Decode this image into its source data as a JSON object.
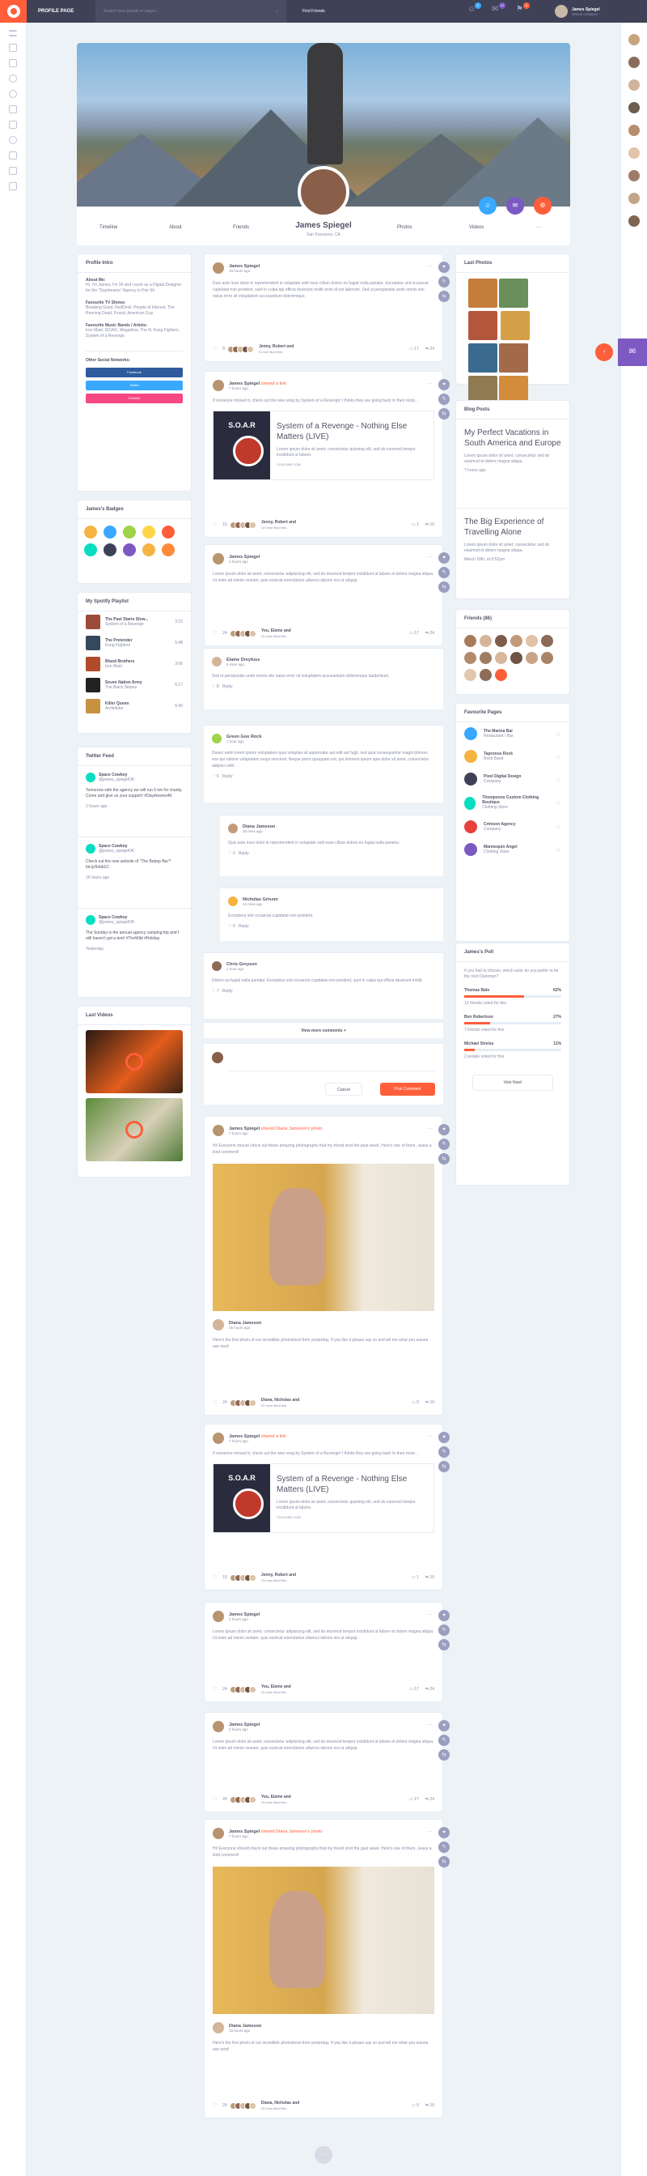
{
  "topbar": {
    "page_title": "PROFILE PAGE",
    "search_placeholder": "Search here people or pages...",
    "find_friends": "Find Friends",
    "notif_counts": [
      "6",
      "12",
      "8"
    ],
    "user_name": "James Spiegel",
    "user_status": "SPACE COWBOY"
  },
  "profile": {
    "name": "James Spiegel",
    "location": "San Francisco, CA",
    "tabs_left": [
      "Timeline",
      "About",
      "Friends"
    ],
    "tabs_right": [
      "Photos",
      "Videos",
      "···"
    ]
  },
  "intro": {
    "title": "Profile Intro",
    "about_label": "About Me:",
    "about_text": "Hi, I'm James, I'm 36 and I work as a Digital Designer for the \"Daydreams\" Agency in Pier 56.",
    "tv_label": "Favourite TV Shows:",
    "tv_text": "Breaking Good, RedDevil, People of Interest, The Running Dead, Found, American Guy.",
    "music_label": "Favourite Music Bands / Artists:",
    "music_text": "Iron Maid, DC/AC, Megablow, The Ill, Kung Fighters, System of a Revenge.",
    "social_label": "Other Social Networks:",
    "social": [
      "Facebook",
      "Twitter",
      "Dribbble"
    ]
  },
  "badges": {
    "title": "James's Badges"
  },
  "playlist": {
    "title": "My Spotify Playlist",
    "items": [
      {
        "song": "The Past Starts Slow...",
        "artist": "System of a Revenge",
        "time": "3:22"
      },
      {
        "song": "The Pretender",
        "artist": "Kung Fighters",
        "time": "5:48"
      },
      {
        "song": "Blood Brothers",
        "artist": "Iron Maid",
        "time": "3:06"
      },
      {
        "song": "Seven Nation Army",
        "artist": "The Black Stripes",
        "time": "6:17"
      },
      {
        "song": "Killer Queen",
        "artist": "Archiduke",
        "time": "5:40"
      }
    ]
  },
  "twitter": {
    "title": "Twitter Feed",
    "tweets": [
      {
        "name": "Space Cowboy",
        "handle": "@james_spiegelOK",
        "text": "Tomorrow with the agency we will run 5 km for charity. Come and give us your support! #Daydreams4K",
        "time": "2 hours ago"
      },
      {
        "name": "Space Cowboy",
        "handle": "@james_spiegelOK",
        "text": "Check out the new website of \"The Bebop Bar\"! bit.ly/9xbb1C",
        "time": "16 hours ago"
      },
      {
        "name": "Space Cowboy",
        "handle": "@james_spiegelOK",
        "text": "The Sunday is the annual agency camping trip and I still haven't got a tent! #TheWild #Holiday",
        "time": "Yesterday"
      }
    ]
  },
  "videos": {
    "title": "Last Videos"
  },
  "photos": {
    "title": "Last Photos"
  },
  "blog": {
    "title": "Blog Posts",
    "items": [
      {
        "title": "My Perfect Vacations in South America and Europe",
        "text": "Lorem ipsum dolor sit amet, consectetur sed do eiusmod et dolore magna aliqua.",
        "time": "7 hours ago"
      },
      {
        "title": "The Big Experience of Travelling Alone",
        "text": "Lorem ipsum dolor sit amet, consectetur sed do eiusmod et dolore magna aliqua.",
        "time": "March 18th, at 6:52pm"
      }
    ]
  },
  "friends": {
    "title": "Friends (86)"
  },
  "pages": {
    "title": "Favourite Pages",
    "items": [
      {
        "name": "The Marina Bar",
        "type": "Restaurant / Bar"
      },
      {
        "name": "Tapronus Rock",
        "type": "Rock Band"
      },
      {
        "name": "Pixel Digital Design",
        "type": "Company"
      },
      {
        "name": "Thompsons Custom Clothing Boutique",
        "type": "Clothing Store"
      },
      {
        "name": "Crimson Agency",
        "type": "Company"
      },
      {
        "name": "Mannequin Angel",
        "type": "Clothing Store"
      }
    ]
  },
  "poll": {
    "title": "James's Poll",
    "question": "If you had to choose, which actor do you prefer to be the next Darkman?",
    "options": [
      {
        "name": "Thomas Bale",
        "pct": "62%",
        "voted": "12 friends voted for this"
      },
      {
        "name": "Ben Robertson",
        "pct": "27%",
        "voted": "7 friends voted for this"
      },
      {
        "name": "Michael Streiss",
        "pct": "11%",
        "voted": "2 people voted for this"
      }
    ],
    "pcts": [
      0.62,
      0.27,
      0.11
    ],
    "button": "Vote Now!"
  },
  "posts": [
    {
      "author": "James Spiegel",
      "action": "",
      "time": "19 hours ago",
      "text": "Duis aute irure dolor in reprehenderit in voluptate velit esse cillum dolore eu fugiat nulla pariatur. Excepteur sint occaecat cupidatat non proident, sunt in culpa qui officia deserunt mollit anim id est laborum. Sed ut perspiciatis unde omnis iste natus error sit voluptatem accusantium doloremque.",
      "likes": "8",
      "liker": "Jenny, Robert and",
      "liker2": "6 more liked this",
      "c1": "17",
      "c2": "24"
    },
    {
      "author": "James Spiegel",
      "action": "shared a link",
      "time": "7 hours ago",
      "text": "If someone missed it, check out the new song by System of a Revenge! I thinks they are going back to their roots...",
      "link_title": "System of a Revenge - Nothing Else Matters (LIVE)",
      "link_text": "Lorem ipsum dolor sit amet, consectetur quisning elit, sed do eiusmod tempor incididunt ut labore.",
      "link_url": "YOUTUBE.COM",
      "likes": "15",
      "liker": "Jenny, Robert and",
      "liker2": "13 more liked this",
      "c1": "1",
      "c2": "16"
    },
    {
      "author": "James Spiegel",
      "action": "",
      "time": "2 hours ago",
      "text": "Lorem ipsum dolor sit amet, consectetur adipisicing elit, sed do eiusmod tempor incididunt ut labore et dolore magna aliqua. Ut enim ad minim veniam, quis nostrud exercitation ullamco laboris nisi ut aliquip.",
      "likes": "24",
      "liker": "You, Elaine and",
      "liker2": "22 more liked this",
      "c1": "17",
      "c2": "24"
    },
    {
      "author": "James Spiegel",
      "action": "shared Diana Jameson's photo",
      "time": "7 hours ago",
      "text": "Hi! Everyone should check out these amazing photographs that my friend shot the past week. Here's one of them...leave a kind comment!",
      "shared": "Diana Jameson",
      "shared_time": "16 hours ago",
      "shared_text": "Here's the first photo of our incredible photoshoot from yesterday. If you like it please say so and tell me what you wanna see next!",
      "likes": "24",
      "liker": "Diana, Nicholas and",
      "liker2": "22 more liked this",
      "c1": "0",
      "c2": "16"
    },
    {
      "author": "James Spiegel",
      "action": "shared a link",
      "time": "7 hours ago",
      "text": "If someone missed it, check out the new song by System of a Revenge! I thinks they are going back to their roots...",
      "link_title": "System of a Revenge - Nothing Else Matters (LIVE)",
      "link_text": "Lorem ipsum dolor sit amet, consectetur quisning elit, sed do eiusmod tempor incididunt ut labore.",
      "link_url": "YOUTUBE.COM",
      "likes": "15",
      "liker": "Jenny, Robert and",
      "liker2": "13 more liked this",
      "c1": "1",
      "c2": "16"
    },
    {
      "author": "James Spiegel",
      "action": "",
      "time": "2 hours ago",
      "text": "Lorem ipsum dolor sit amet, consectetur adipisicing elit, sed do eiusmod tempor incididunt ut labore et dolore magna aliqua. Ut enim ad minim veniam, quis nostrud exercitation ullamco laboris nisi ut aliquip.",
      "likes": "24",
      "liker": "You, Elaine and",
      "liker2": "22 more liked this",
      "c1": "17",
      "c2": "24"
    },
    {
      "author": "James Spiegel",
      "action": "",
      "time": "2 hours ago",
      "text": "Lorem ipsum dolor sit amet, consectetur adipisicing elit, sed do eiusmod tempor incididunt ut labore et dolore magna aliqua. Ut enim ad minim veniam, quis nostrud exercitation ullamco laboris nisi ut aliquip.",
      "likes": "24",
      "liker": "You, Elaine and",
      "liker2": "22 more liked this",
      "c1": "17",
      "c2": "24"
    },
    {
      "author": "James Spiegel",
      "action": "shared Diana Jameson's photo",
      "time": "7 hours ago",
      "text": "Hi! Everyone should check out these amazing photographs that my friend shot the past week. Here's one of them...leave a kind comment!",
      "shared": "Diana Jameson",
      "shared_time": "16 hours ago",
      "shared_text": "Here's the first photo of our incredible photoshoot from yesterday. If you like it please say so and tell me what you wanna see next!",
      "likes": "24",
      "liker": "Diana, Nicholas and",
      "liker2": "22 more liked this",
      "c1": "0",
      "c2": "16"
    }
  ],
  "comments": [
    {
      "name": "Elaine Dreyfuss",
      "time": "5 mins ago",
      "text": "Sed ut perspiciatis unde omnis iste natus error sit voluptatem accusantium doloremque laudantium.",
      "likes": "8"
    },
    {
      "name": "Green Goo Rock",
      "time": "1 hour ago",
      "text": "Donec enim lorem ipsum voluptatem quia voluptas sit aspernatur aut odit aut fugit, sed quia consequuntur magni dolores eos qui ratione voluptatem sequi nesciunt. Neque porro quisquam est, qui dolorem ipsum quia dolor sit amet, consectetur adipisci velit.",
      "likes": "5"
    },
    {
      "name": "Diana Jameson",
      "time": "39 mins ago",
      "text": "Quis aute irure dolor in reprehenderit in voluptate velit esse cillum dolore eu fugiat nulla pariatur.",
      "likes": "3"
    },
    {
      "name": "Nicholas Grisom",
      "time": "24 mins ago",
      "text": "Excepteur sint occaecat cupidatat non proident.",
      "likes": "0"
    },
    {
      "name": "Chris Greyson",
      "time": "1 hour ago",
      "text": "Dolore eu fugiat nulla pariatur. Excepteur sint occaecat cupidatat non proident, sunt in culpa qui officia deserunt mollit.",
      "likes": "7"
    }
  ],
  "comment_ui": {
    "reply": "Reply",
    "view_more": "View more comments +",
    "cancel": "Cancel",
    "post_comment": "Post Comment"
  }
}
